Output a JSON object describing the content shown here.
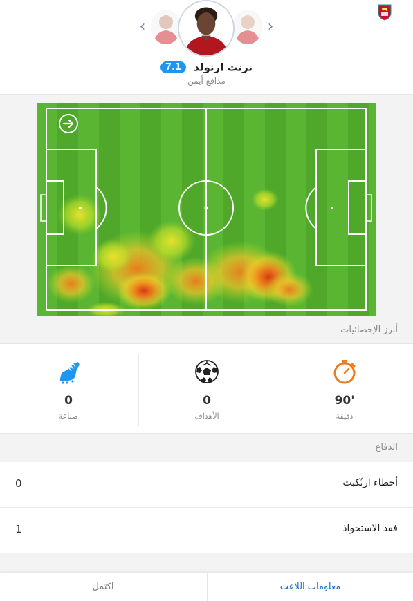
{
  "header": {
    "player_name": "ترنت ارنولد",
    "rating": "7.1",
    "position": "مدافع أيمن",
    "nav_prev_icon": "chevron-left-icon",
    "nav_next_icon": "chevron-right-icon",
    "club_badge_icon": "liverpool-crest-icon",
    "colors": {
      "rating_badge": "#1e96f0",
      "accent": "#1a73c8"
    }
  },
  "heatmap": {
    "direction_icon": "arrow-right-icon",
    "pitch_color": "#4fa82a"
  },
  "highlights": {
    "title": "أبرز الإحصائيات",
    "stats": [
      {
        "icon": "stopwatch-icon",
        "value": "90'",
        "label": "دقيقة",
        "color": "#f07c1e"
      },
      {
        "icon": "football-icon",
        "value": "0",
        "label": "الأهداف"
      },
      {
        "icon": "football-boot-icon",
        "value": "0",
        "label": "صناعة",
        "color": "#1e96f0"
      }
    ]
  },
  "defence": {
    "title": "الدفاع",
    "rows": [
      {
        "label": "أخطاء ارتُكبت",
        "value": "0"
      },
      {
        "label": "فقد الاستحواذ",
        "value": "1"
      }
    ]
  },
  "bottom_bar": {
    "player_info_label": "معلومات اللاعب",
    "done_label": "اكتمل"
  }
}
